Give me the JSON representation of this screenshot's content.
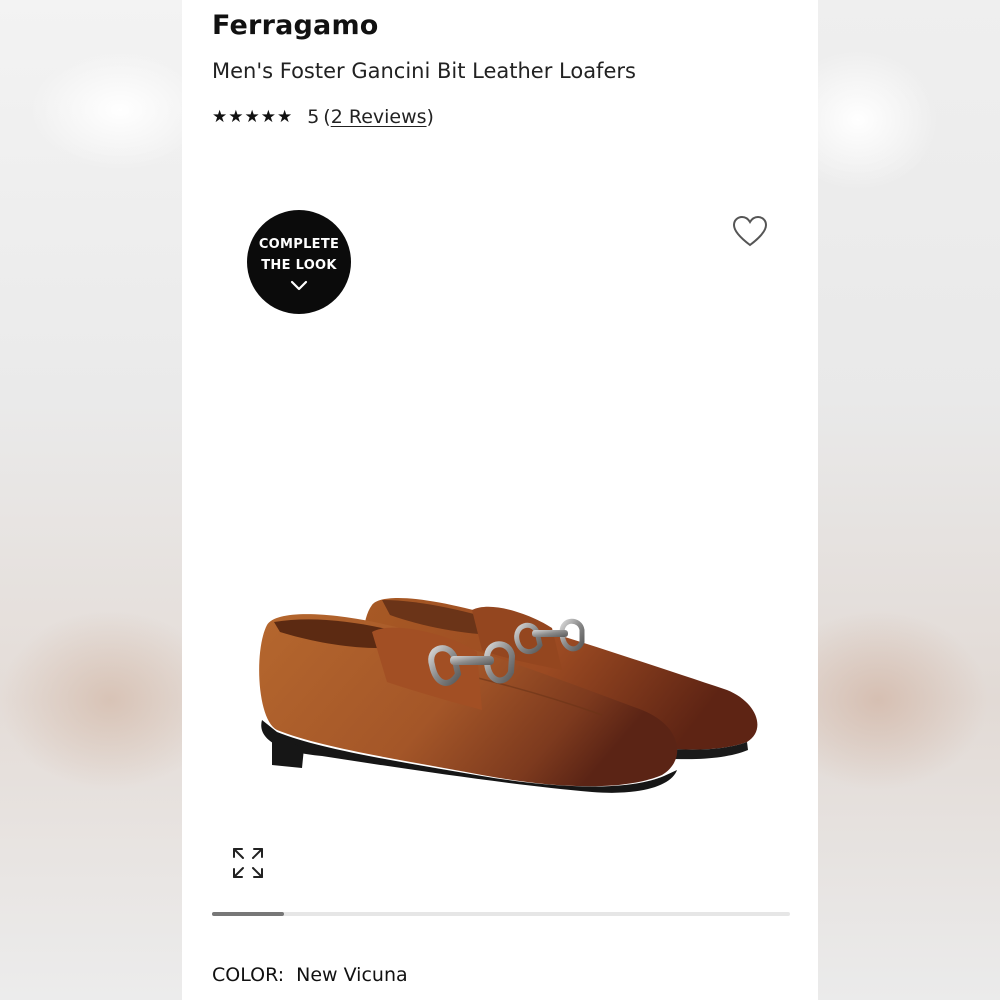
{
  "product": {
    "brand": "Ferragamo",
    "title": "Men's Foster Gancini Bit Leather Loafers",
    "rating": {
      "stars": "★★★★★",
      "value": "5",
      "open_paren": "(",
      "reviews_link": "2 Reviews",
      "close_paren": ")"
    }
  },
  "gallery": {
    "complete_look_line1": "COMPLETE",
    "complete_look_line2": "THE LOOK",
    "icons": {
      "complete_look": "chevron-down-icon",
      "favorite": "heart-icon",
      "expand": "expand-icon"
    },
    "image_progress": 0.125,
    "colors": {
      "leather_light": "#b5672e",
      "leather_dark": "#6e2e19",
      "sole": "#1a1a1a",
      "buckle": "#9a9a9a"
    }
  },
  "color": {
    "label": "COLOR:",
    "value": "New Vicuna"
  }
}
